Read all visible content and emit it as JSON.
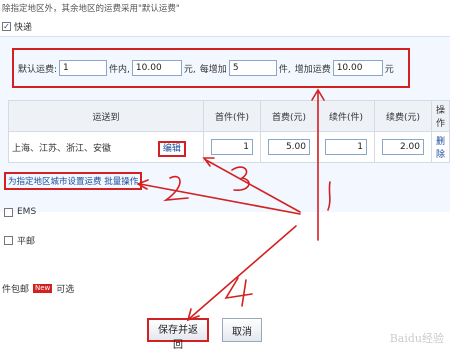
{
  "note": {
    "text": "除指定地区外，其余地区的运费采用\"默认运费\""
  },
  "express": {
    "label": "快递",
    "checked": true
  },
  "default_fee": {
    "label": "默认运费:",
    "first_qty": "1",
    "first_unit": "件内,",
    "first_fee": "10.00",
    "yuan1": "元,",
    "each_add": "每增加",
    "add_qty": "5",
    "add_unit": "件,",
    "add_fee_label": "增加运费",
    "add_fee": "10.00",
    "yuan2": "元"
  },
  "table": {
    "headers": [
      "运送到",
      "首件(件)",
      "首费(元)",
      "续件(件)",
      "续费(元)",
      "操作"
    ],
    "rows": [
      {
        "region": "上海、江苏、浙江、安徽",
        "edit": "编辑",
        "first_qty": "1",
        "first_fee": "5.00",
        "add_qty": "1",
        "add_fee": "2.00",
        "op": "删除"
      }
    ]
  },
  "batch_link": "为指定地区城市设置运费 批量操作",
  "options": [
    {
      "label": "EMS",
      "checked": false
    },
    {
      "label": "平邮",
      "checked": false
    }
  ],
  "free_shipping": {
    "label": "件包邮",
    "badge": "New",
    "suffix": "可选"
  },
  "buttons": {
    "save": "保存并返回",
    "cancel": "取消"
  },
  "annotations": {
    "n1": "1",
    "n2": "2",
    "n3": "3",
    "n4": "4"
  },
  "watermark": "Baidu经验",
  "colors": {
    "annotation_red": "#d32020",
    "link_blue": "#1a4c9a",
    "panel_bg": "#f3f7ff"
  }
}
